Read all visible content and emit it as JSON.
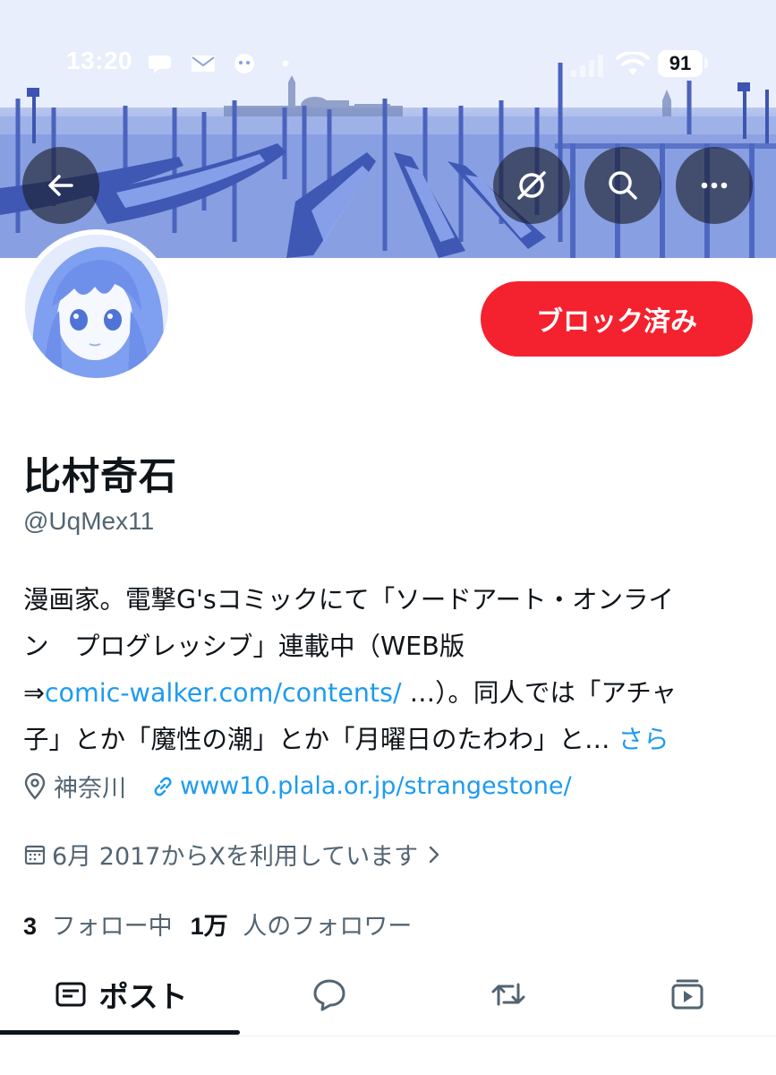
{
  "status_bar": {
    "time": "13:20",
    "battery": "91",
    "notification_icons": [
      "chat-icon",
      "mail-icon",
      "app-badge-icon",
      "dot-icon"
    ],
    "signal_icon": "cellular-signal-icon",
    "wifi_icon": "wifi-icon"
  },
  "banner": {
    "buttons": [
      "back-icon",
      "grok-icon",
      "search-icon",
      "more-icon"
    ]
  },
  "profile": {
    "display_name": "比村奇石",
    "handle": "@UqMex11",
    "block_button_label": "ブロック済み",
    "bio": {
      "line1": "漫画家。電撃G'sコミックにて「ソードアート・オンライ",
      "line2": "ン　プログレッシブ」連載中（WEB版",
      "line3_prefix": "⇒",
      "line3_link": "comic-walker.com/contents/",
      "line3_suffix": " …）。同人では「アチャ",
      "line4": "子」とか「魔性の潮」とか「月曜日のたわわ」と…",
      "more_link": "さら"
    },
    "location": "神奈川",
    "website": "www10.plala.or.jp/strangestone/",
    "joined": "6月 2017からXを利用しています",
    "following_count": "3",
    "following_label": "フォロー中",
    "followers_count": "1万",
    "followers_label": "人のフォロワー"
  },
  "tabs": {
    "posts_label": "ポスト",
    "icons": [
      "posts-icon",
      "replies-icon",
      "reposts-icon",
      "media-icon"
    ]
  },
  "colors": {
    "accent_link": "#1d9bf0",
    "block_red": "#f4212e",
    "secondary_text": "#536471"
  }
}
